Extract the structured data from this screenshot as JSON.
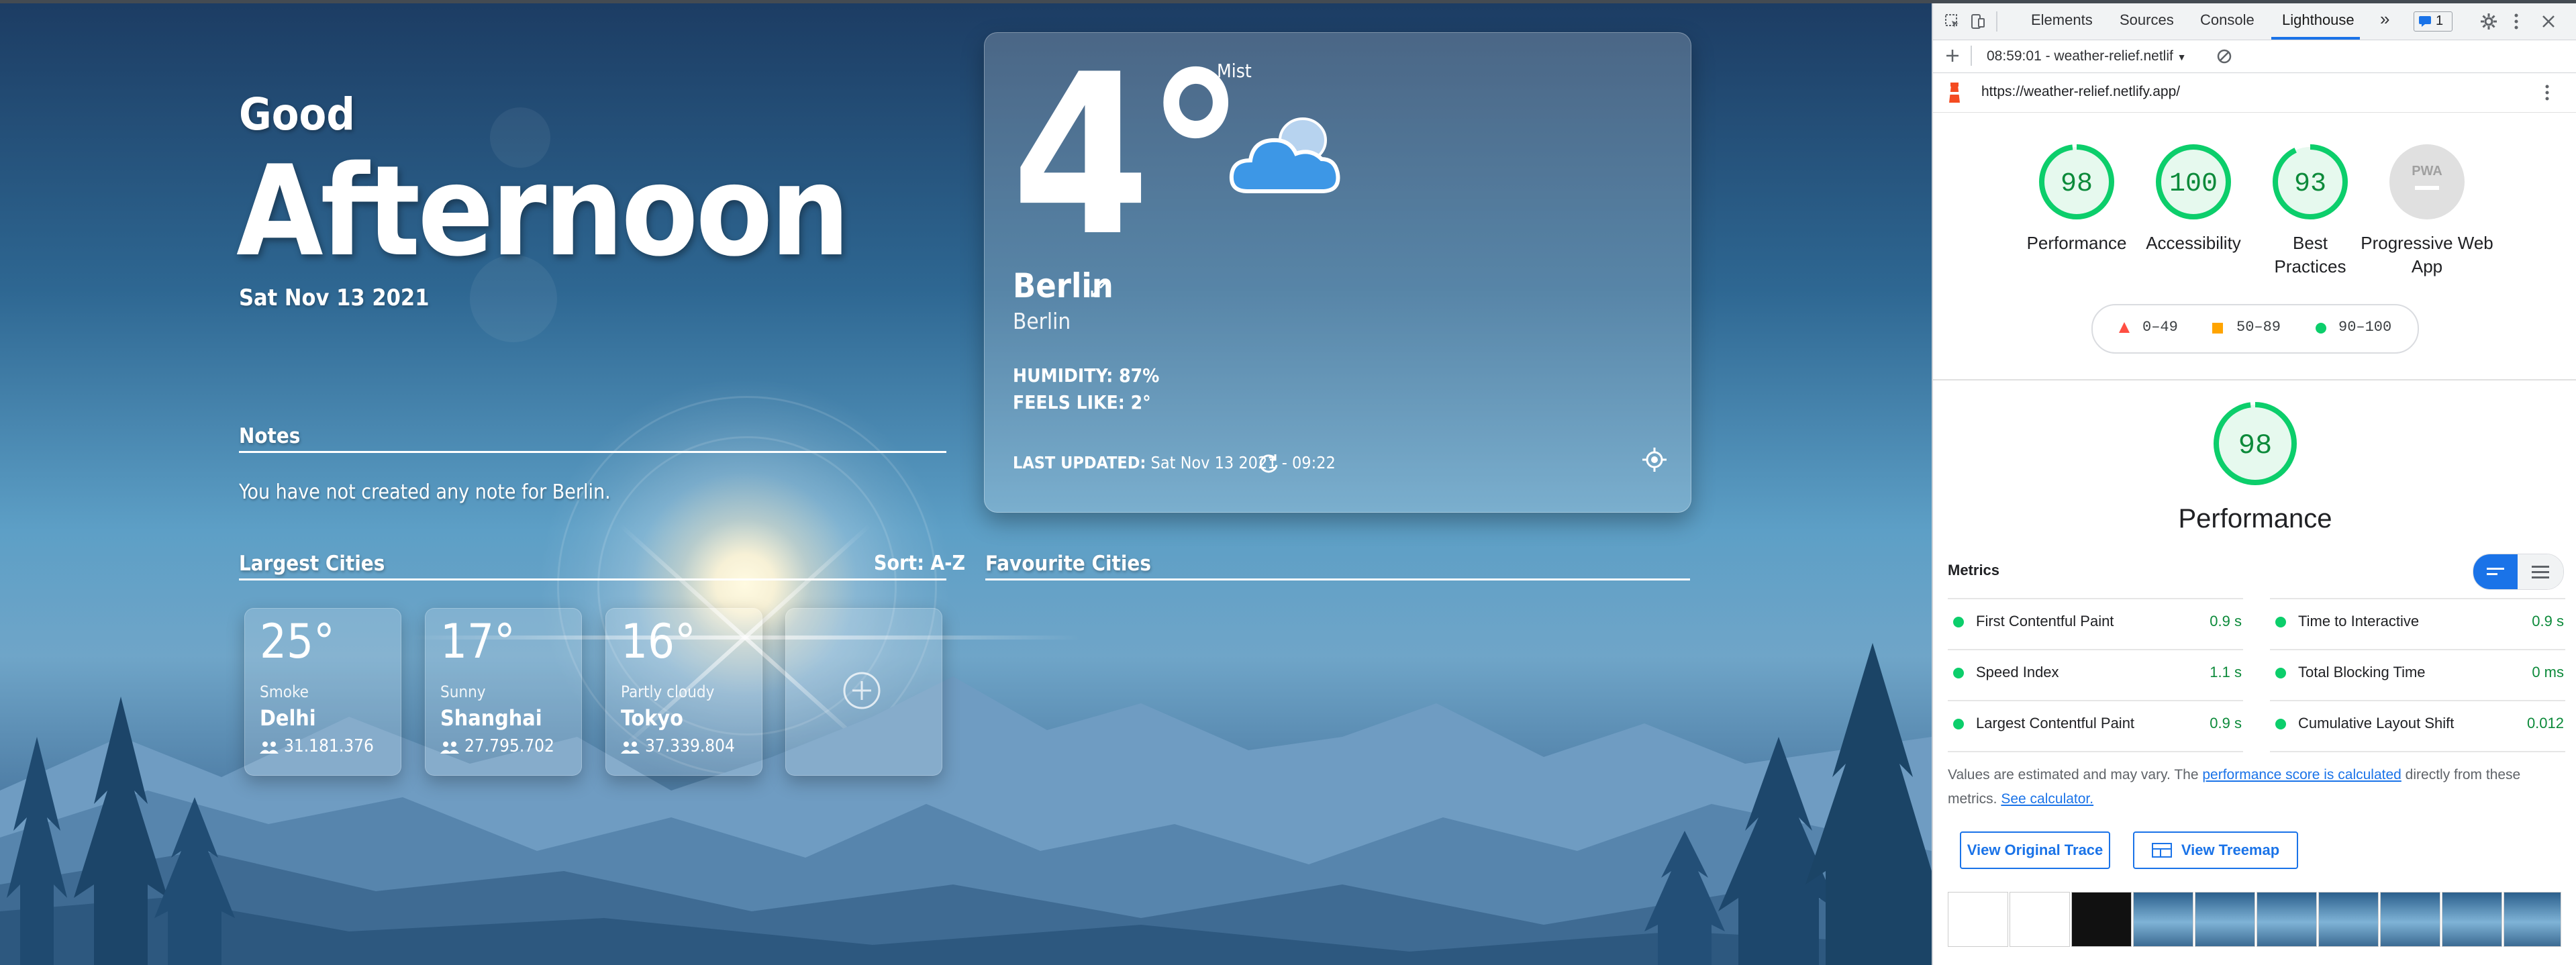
{
  "app": {
    "greeting": {
      "line1": "Good",
      "line2": "Afternoon",
      "date": "Sat Nov 13 2021"
    },
    "notes": {
      "title": "Notes",
      "text": "You have not created any note for Berlin."
    },
    "largest_cities": {
      "title": "Largest Cities",
      "sort": "Sort: A-Z",
      "cities": [
        {
          "temp": "25°",
          "condition": "Smoke",
          "name": "Delhi",
          "population": "31.181.376"
        },
        {
          "temp": "17°",
          "condition": "Sunny",
          "name": "Shanghai",
          "population": "27.795.702"
        },
        {
          "temp": "16°",
          "condition": "Partly cloudy",
          "name": "Tokyo",
          "population": "37.339.804"
        }
      ]
    },
    "favourite_cities": {
      "title": "Favourite Cities"
    },
    "current": {
      "temp": "4°",
      "condition": "Mist",
      "city": "Berlin",
      "country": "Berlin",
      "humidity": "HUMIDITY: 87%",
      "feels_like": "FEELS LIKE: 2°",
      "last_updated_label": "LAST UPDATED:",
      "last_updated_value": "Sat Nov 13 2021 - 09:22"
    }
  },
  "devtools": {
    "tabs": [
      "Elements",
      "Sources",
      "Console",
      "Lighthouse"
    ],
    "active_tab": "Lighthouse",
    "more": "»",
    "issues_count": "1",
    "report_selector": "08:59:01 - weather-relief.netlif",
    "url": "https://weather-relief.netlify.app/",
    "scores": [
      {
        "value": "98",
        "label": "Performance"
      },
      {
        "value": "100",
        "label": "Accessibility"
      },
      {
        "value": "93",
        "label": "Best Practices"
      },
      {
        "value": "PWA",
        "label": "Progressive Web App"
      }
    ],
    "legend": [
      "0–49",
      "50–89",
      "90–100"
    ],
    "performance": {
      "score": "98",
      "title": "Performance"
    },
    "metrics_title": "Metrics",
    "metrics": [
      {
        "name": "First Contentful Paint",
        "value": "0.9 s"
      },
      {
        "name": "Time to Interactive",
        "value": "0.9 s"
      },
      {
        "name": "Speed Index",
        "value": "1.1 s"
      },
      {
        "name": "Total Blocking Time",
        "value": "0 ms"
      },
      {
        "name": "Largest Contentful Paint",
        "value": "0.9 s"
      },
      {
        "name": "Cumulative Layout Shift",
        "value": "0.012"
      }
    ],
    "note": {
      "pre": "Values are estimated and may vary. The ",
      "link1": "performance score is calculated",
      "mid": " directly from these metrics. ",
      "link2": "See calculator."
    },
    "buttons": {
      "trace": "View Original Trace",
      "treemap": "View Treemap"
    },
    "colors": {
      "pass": "#0cce6b",
      "average": "#ffa400",
      "fail": "#ff4e42",
      "accent": "#1a73e8"
    }
  }
}
